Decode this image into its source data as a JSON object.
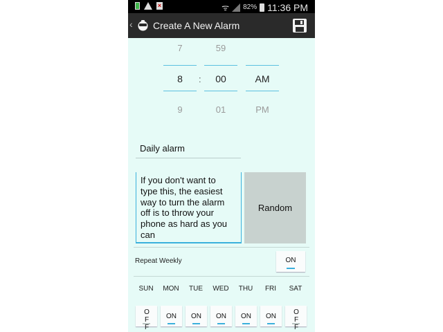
{
  "status_bar": {
    "battery_percent": "82%",
    "time": "11:36 PM"
  },
  "action_bar": {
    "back_glyph": "‹",
    "title": "Create A New Alarm",
    "icons": [
      "app-logo-icon",
      "save-floppy-icon"
    ]
  },
  "time_picker": {
    "hour": {
      "prev": "7",
      "selected": "8",
      "next": "9"
    },
    "separator": ":",
    "minute": {
      "prev": "59",
      "selected": "00",
      "next": "01"
    },
    "ampm": {
      "selected": "AM",
      "next": "PM"
    },
    "accent_color": "#5bc0e0"
  },
  "alarm_name": {
    "value": "Daily alarm"
  },
  "message": {
    "lines": [
      "If you don't want to",
      "type this, the easiest",
      "way to turn the alarm",
      "off is to throw your",
      "phone as hard as you",
      "can"
    ]
  },
  "random_button": {
    "label": "Random"
  },
  "repeat": {
    "label": "Repeat Weekly",
    "toggle": "ON"
  },
  "days": [
    {
      "label": "SUN",
      "state": "OF F"
    },
    {
      "label": "MON",
      "state": "ON"
    },
    {
      "label": "TUE",
      "state": "ON"
    },
    {
      "label": "WED",
      "state": "ON"
    },
    {
      "label": "THU",
      "state": "ON"
    },
    {
      "label": "FRI",
      "state": "ON"
    },
    {
      "label": "SAT",
      "state": "OF F"
    }
  ],
  "colors": {
    "background": "#e6fbf7",
    "accent": "#3ab0dc",
    "action_bar": "#2a2a2a",
    "random_button": "#c8d2cf"
  }
}
